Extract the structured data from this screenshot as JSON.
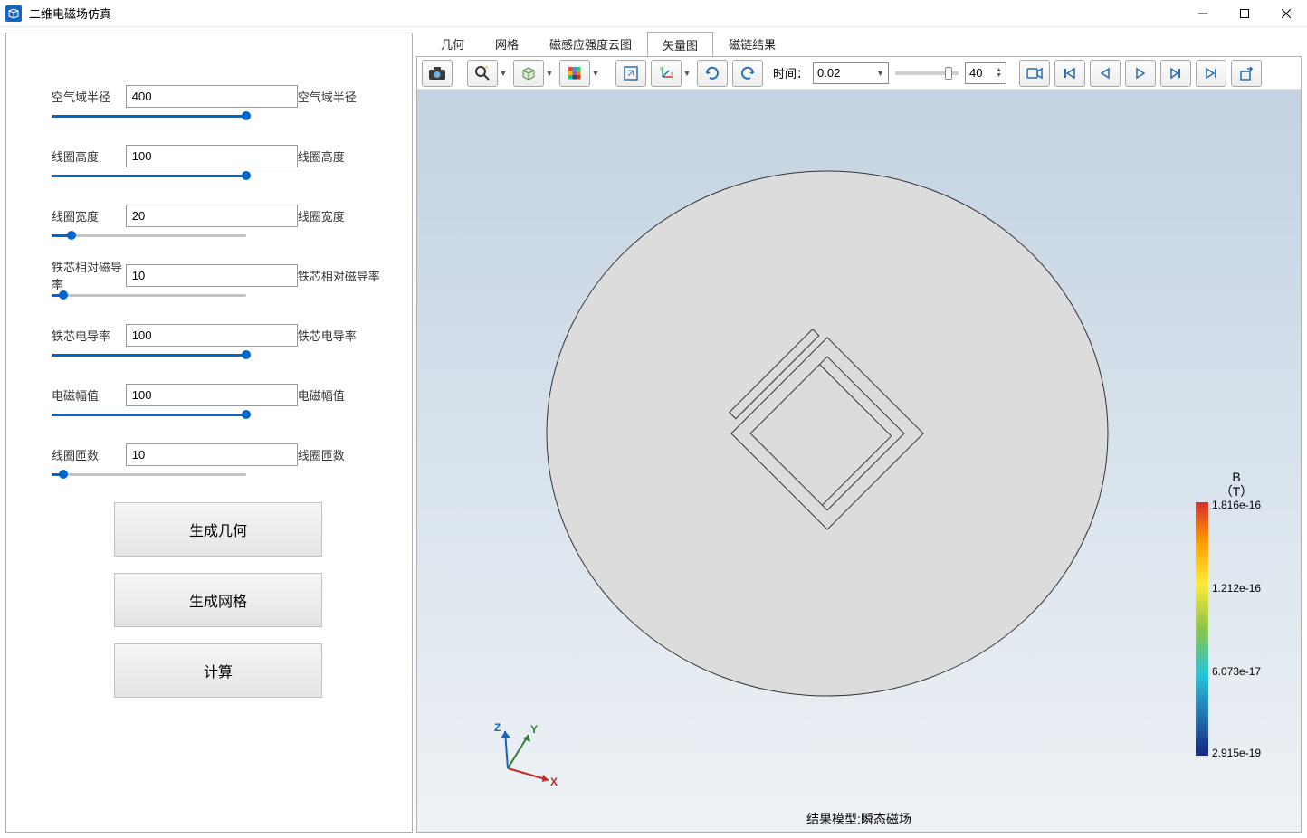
{
  "window": {
    "title": "二维电磁场仿真"
  },
  "params": [
    {
      "label": "空气域半径",
      "value": "400",
      "rlabel": "空气域半径",
      "pct": 100
    },
    {
      "label": "线圈高度",
      "value": "100",
      "rlabel": "线圈高度",
      "pct": 100
    },
    {
      "label": "线圈宽度",
      "value": "20",
      "rlabel": "线圈宽度",
      "pct": 10
    },
    {
      "label": "铁芯相对磁导率",
      "value": "10",
      "rlabel": "铁芯相对磁导率",
      "pct": 6
    },
    {
      "label": "铁芯电导率",
      "value": "100",
      "rlabel": "铁芯电导率",
      "pct": 100
    },
    {
      "label": "电磁幅值",
      "value": "100",
      "rlabel": "电磁幅值",
      "pct": 100
    },
    {
      "label": "线圈匝数",
      "value": "10",
      "rlabel": "线圈匝数",
      "pct": 6
    }
  ],
  "buttons": {
    "gen_geom": "生成几何",
    "gen_mesh": "生成网格",
    "compute": "计算"
  },
  "tabs": [
    "几何",
    "网格",
    "磁感应强度云图",
    "矢量图",
    "磁链结果"
  ],
  "active_tab": 3,
  "time": {
    "label": "时间：",
    "value": "0.02",
    "frame": "40"
  },
  "result_label": "结果模型:瞬态磁场",
  "legend": {
    "title_line1": "B",
    "title_line2": "（T）",
    "ticks": [
      "1.816e-16",
      "1.212e-16",
      "6.073e-17",
      "2.915e-19"
    ]
  },
  "axis": {
    "x": "X",
    "y": "Y",
    "z": "Z"
  }
}
